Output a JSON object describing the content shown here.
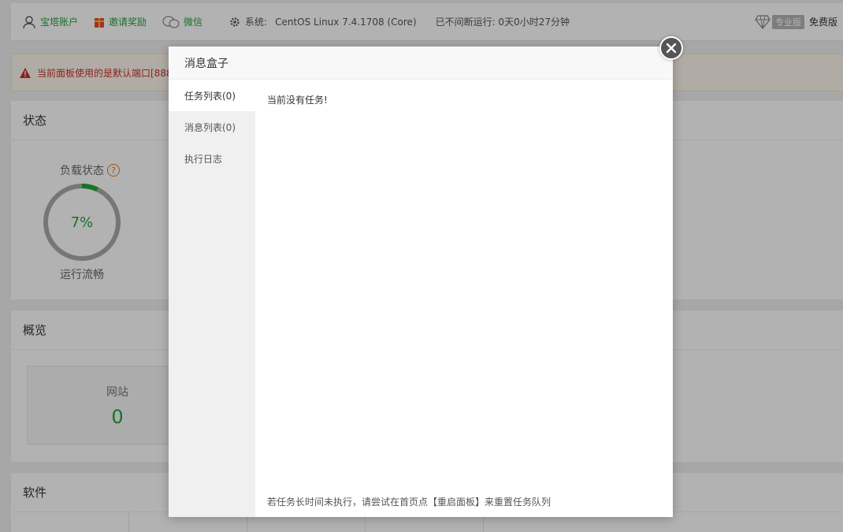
{
  "topbar": {
    "account_label": "宝塔账户",
    "invite_label": "邀请奖励",
    "wechat_label": "微信",
    "system_prefix": "系统:",
    "system_value": "CentOS Linux 7.4.1708 (Core)",
    "uptime": "已不间断运行: 0天0小时27分钟",
    "pro_label": "专业版",
    "free_label": "免费版"
  },
  "warning": {
    "text": "当前面板使用的是默认端口[888"
  },
  "status_panel": {
    "title": "状态",
    "load_label": "负载状态",
    "help_glyph": "?",
    "load_value": "7%",
    "load_percent": 7,
    "load_state": "运行流畅"
  },
  "overview_panel": {
    "title": "概览",
    "site_label": "网站",
    "site_count": "0"
  },
  "software_panel": {
    "title": "软件"
  },
  "modal": {
    "title": "消息盒子",
    "tabs": [
      {
        "label": "任务列表(0)"
      },
      {
        "label": "消息列表(0)"
      },
      {
        "label": "执行日志"
      }
    ],
    "empty_text": "当前没有任务!",
    "footer_note": "若任务长时间未执行，请尝试在首页点【重启面板】来重置任务队列"
  },
  "colors": {
    "accent": "#20a53a",
    "warning_text": "#c9302c",
    "help": "#e07b1a"
  }
}
